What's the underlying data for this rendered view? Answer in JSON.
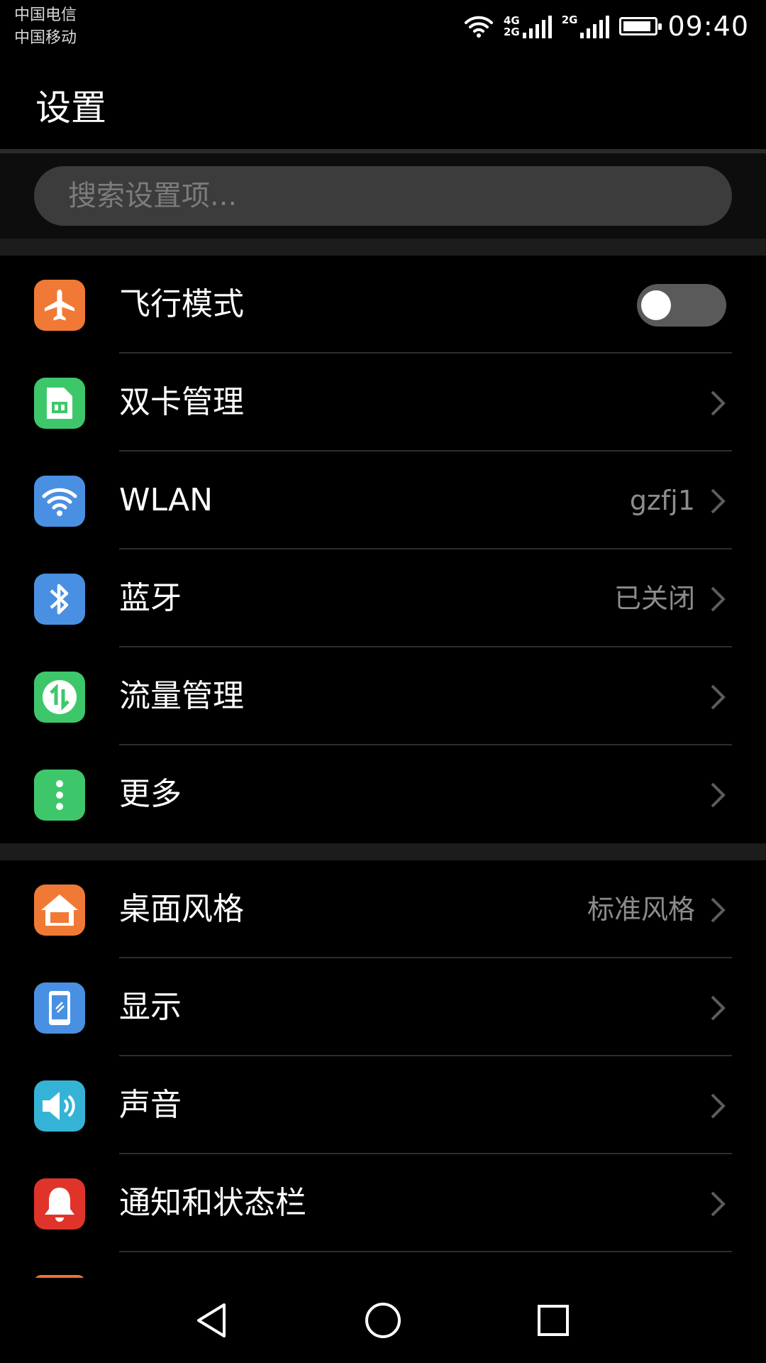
{
  "status_bar": {
    "carrier_1": "中国电信",
    "carrier_2": "中国移动",
    "net_1_top": "4G",
    "net_1_bottom": "2G",
    "net_2": "2G",
    "time": "09:40",
    "battery_level": 0.9
  },
  "header": {
    "title": "设置"
  },
  "search": {
    "placeholder": "搜索设置项..."
  },
  "groups": [
    {
      "items": [
        {
          "label": "飞行模式",
          "icon": "airplane-icon",
          "color": "#f07a35",
          "control": "toggle",
          "toggle_on": false
        },
        {
          "label": "双卡管理",
          "icon": "sim-card-icon",
          "color": "#3ec76a"
        },
        {
          "label": "WLAN",
          "value": "gzfj1",
          "icon": "wifi-icon",
          "color": "#4a90e2"
        },
        {
          "label": "蓝牙",
          "value": "已关闭",
          "icon": "bluetooth-icon",
          "color": "#4a90e2"
        },
        {
          "label": "流量管理",
          "icon": "data-usage-icon",
          "color": "#3ec76a"
        },
        {
          "label": "更多",
          "icon": "more-dots-icon",
          "color": "#3ec76a"
        }
      ]
    },
    {
      "items": [
        {
          "label": "桌面风格",
          "value": "标准风格",
          "icon": "home-icon",
          "color": "#f07a35"
        },
        {
          "label": "显示",
          "icon": "display-icon",
          "color": "#4a90e2"
        },
        {
          "label": "声音",
          "icon": "speaker-icon",
          "color": "#35b3d6"
        },
        {
          "label": "通知和状态栏",
          "icon": "bell-icon",
          "color": "#e0342a"
        }
      ]
    }
  ],
  "nav_bar": {
    "back": "back-icon",
    "home": "home-circle-icon",
    "recents": "recents-square-icon"
  }
}
